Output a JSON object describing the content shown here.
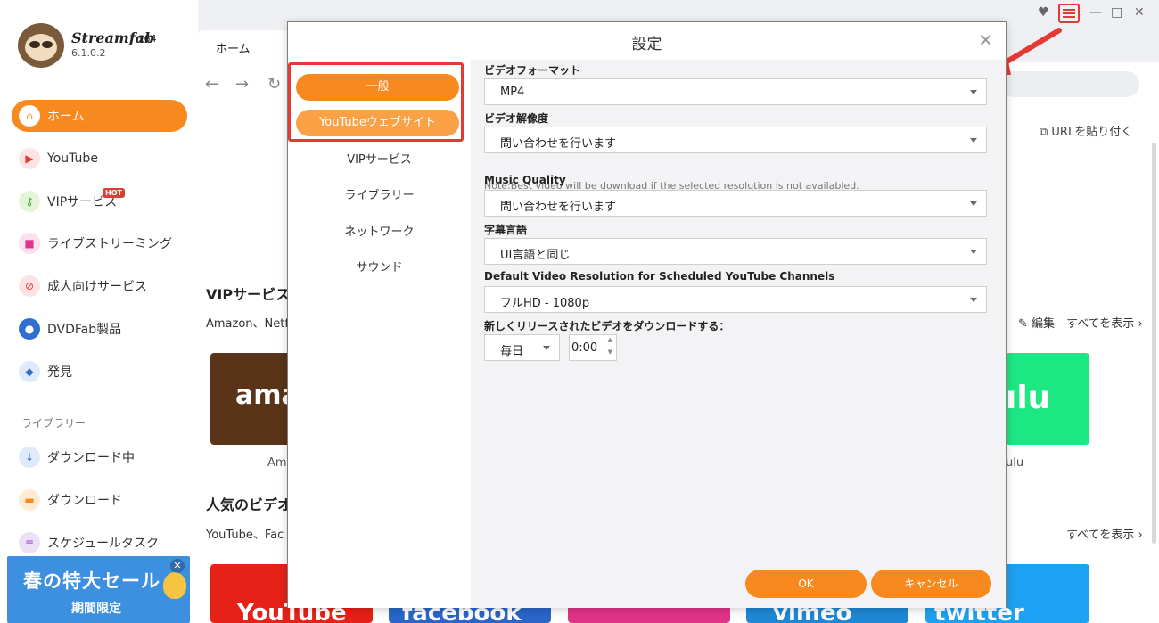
{
  "app": {
    "brand": "Streamfab",
    "arch": "x64",
    "version": "6.1.0.2"
  },
  "sidebar": {
    "items": [
      {
        "label": "ホーム",
        "icon": "home-icon"
      },
      {
        "label": "YouTube",
        "icon": "youtube-icon"
      },
      {
        "label": "VIPサービス",
        "icon": "key-icon",
        "badge": "HOT"
      },
      {
        "label": "ライブストリーミング",
        "icon": "camera-icon"
      },
      {
        "label": "成人向けサービス",
        "icon": "adult-icon"
      },
      {
        "label": "DVDFab製品",
        "icon": "dvdfab-icon"
      },
      {
        "label": "発見",
        "icon": "compass-icon"
      }
    ],
    "library_label": "ライブラリー",
    "library_items": [
      {
        "label": "ダウンロード中",
        "icon": "download-icon"
      },
      {
        "label": "ダウンロード",
        "icon": "folder-icon"
      },
      {
        "label": "スケジュールタスク",
        "icon": "schedule-icon"
      }
    ],
    "banner": {
      "title": "春の特大セール",
      "subtitle": "期間限定",
      "close": "✕"
    }
  },
  "main": {
    "tab": "ホーム",
    "paste_url": "URLを貼り付く",
    "vip_heading": "VIPサービス",
    "vip_sub": "Amazon、Netf",
    "edit": "編集",
    "show_all": "すべてを表示",
    "popular_heading": "人気のビデオ",
    "popular_sub": "YouTube、Fac",
    "show_all_2": "すべてを表示",
    "tiles": {
      "amazon_text": "ama",
      "amazon_caption": "Am",
      "hulu_text": "ılu",
      "hulu_caption": "ulu",
      "youtube": "YouTube",
      "facebook": "facebook",
      "vimeo": "vimeo",
      "twitter": "twitter"
    }
  },
  "dialog": {
    "title": "設定",
    "close": "✕",
    "categories": {
      "general": "一般",
      "youtube_site": "YouTubeウェブサイト",
      "vip": "VIPサービス",
      "library": "ライブラリー",
      "network": "ネットワーク",
      "sound": "サウンド"
    },
    "fields": {
      "video_format_label": "ビデオフォーマット",
      "video_format_value": "MP4",
      "resolution_label": "ビデオ解像度",
      "resolution_value": "問い合わせを行います",
      "resolution_note": "Note:Best video will be download if the selected resolution is not availabled.",
      "music_label": "Music Quality",
      "music_value": "問い合わせを行います",
      "subtitle_label": "字幕言語",
      "subtitle_value": "UI言語と同じ",
      "default_res_label": "Default Video Resolution for Scheduled YouTube Channels",
      "default_res_value": "フルHD - 1080p",
      "new_release_label": "新しくリリースされたビデオをダウンロードする：",
      "frequency_value": "毎日",
      "time_value": "0:00"
    },
    "buttons": {
      "ok": "OK",
      "cancel": "キャンセル"
    }
  },
  "colors": {
    "accent": "#f7891e",
    "highlight": "#e53935"
  }
}
